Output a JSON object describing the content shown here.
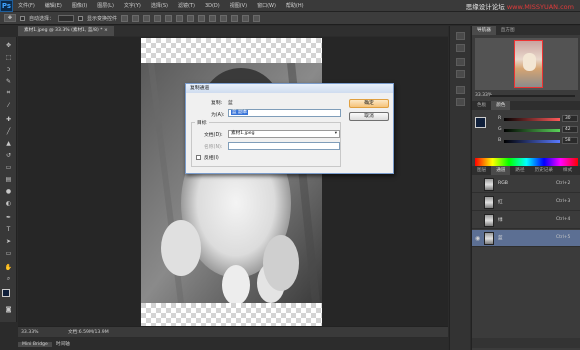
{
  "app": {
    "logo": "Ps"
  },
  "watermark": {
    "prefix": "思缘设计论坛",
    "red": "www.MISSYUAN.com"
  },
  "menu": [
    "文件(F)",
    "编辑(E)",
    "图像(I)",
    "图层(L)",
    "文字(Y)",
    "选择(S)",
    "滤镜(T)",
    "3D(D)",
    "视图(V)",
    "窗口(W)",
    "帮助(H)"
  ],
  "options": {
    "auto_select_label": "自动选择：",
    "show_transform_label": "显示变换控件"
  },
  "document_tab": {
    "title": "素材1.jpeg @ 33.3% (素材1, 蓝/8) * ×"
  },
  "status": {
    "zoom": "33.33%",
    "doc_size": "文档:6.59M/13.9M"
  },
  "bottom_tabs": [
    "Mini Bridge",
    "时间轴"
  ],
  "navigator": {
    "tabs": [
      "导航器",
      "直方图"
    ],
    "zoom": "33.33%"
  },
  "color_panel": {
    "tabs": [
      "色板",
      "颜色"
    ],
    "rows": [
      {
        "label": "R",
        "value": "30",
        "color": "#ff5a5a"
      },
      {
        "label": "G",
        "value": "42",
        "color": "#5ad45a"
      },
      {
        "label": "B",
        "value": "58",
        "color": "#5a7aff"
      }
    ]
  },
  "channels_panel": {
    "tabs": [
      "图层",
      "通道",
      "路径",
      "历史记录",
      "样式"
    ],
    "rows": [
      {
        "name": "RGB",
        "shortcut": "Ctrl+2",
        "selected": false
      },
      {
        "name": "红",
        "shortcut": "Ctrl+3",
        "selected": false
      },
      {
        "name": "绿",
        "shortcut": "Ctrl+4",
        "selected": false
      },
      {
        "name": "蓝",
        "shortcut": "Ctrl+5",
        "selected": true
      }
    ]
  },
  "dialog": {
    "title": "复制通道",
    "copy_label": "复制:",
    "copy_value": "蓝",
    "as_label": "为(A):",
    "as_value": "蓝 副本",
    "group_title": "目标",
    "doc_label": "文档(D):",
    "doc_value": "素材1.jpeg",
    "name_label": "名称(N):",
    "name_value": "",
    "invert_label": "反相(I)",
    "ok_label": "确定",
    "cancel_label": "取消"
  }
}
